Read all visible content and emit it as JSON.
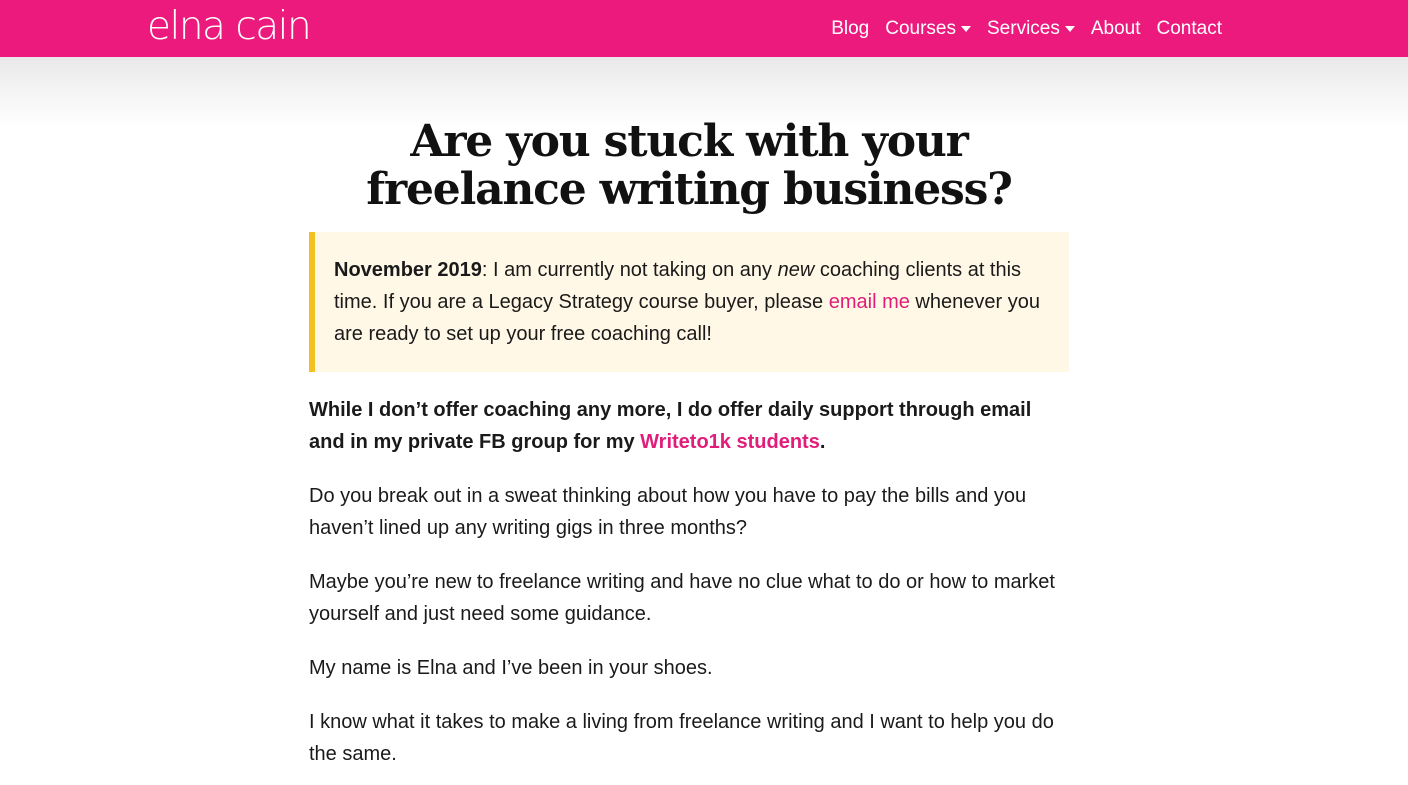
{
  "header": {
    "logo": "elna cain",
    "nav": [
      {
        "label": "Blog",
        "dropdown": false
      },
      {
        "label": "Courses",
        "dropdown": true
      },
      {
        "label": "Services",
        "dropdown": true
      },
      {
        "label": "About",
        "dropdown": false
      },
      {
        "label": "Contact",
        "dropdown": false
      }
    ],
    "brand_color": "#ec1a7d"
  },
  "main": {
    "title": "Are you stuck with your freelance writing business?",
    "notice": {
      "date": "November 2019",
      "text_1": ": I am currently not taking on any ",
      "emphasis": "new",
      "text_2": " coaching clients at this time. If you are a Legacy Strategy course buyer, please ",
      "link": "email me",
      "text_3": " whenever you are ready to set up your free coaching call!",
      "background": "#fff8e6",
      "accent": "#f5c022"
    },
    "paragraphs": {
      "p1_text": "While I don’t offer coaching any more, I do offer daily support through email and in my private FB group for my ",
      "p1_link": "Writeto1k students",
      "p1_end": ".",
      "p2": "Do you break out in a sweat thinking about how you have to pay the bills and you haven’t lined up any writing gigs in three months?",
      "p3": "Maybe you’re new to freelance writing and have no clue what to do or how to market yourself and just need some guidance.",
      "p4": "My name is Elna and I’ve been in your shoes.",
      "p5": "I know what it takes to make a living from freelance writing and I want to help you do the same."
    },
    "link_color": "#e01e7a"
  }
}
